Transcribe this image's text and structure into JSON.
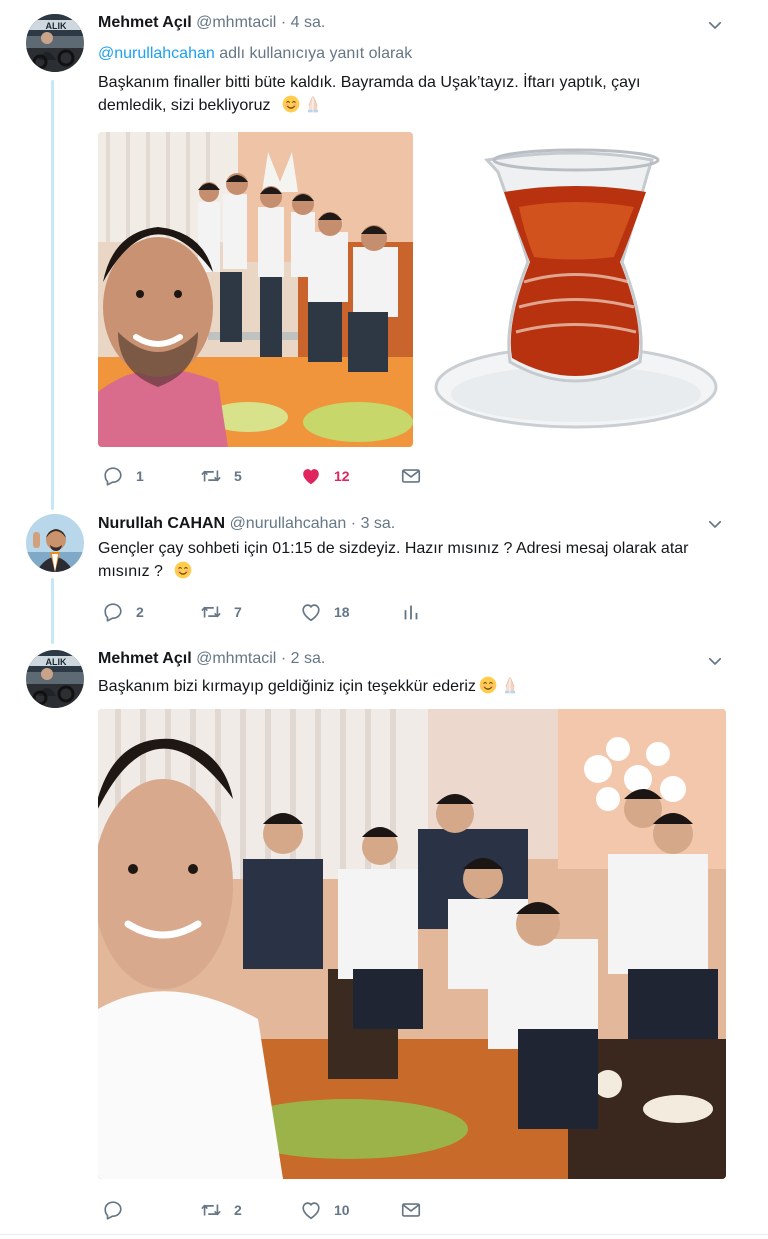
{
  "tweets": [
    {
      "name": "Mehmet Açıl",
      "handle": "@mhmtacil",
      "dot": "·",
      "time": "4 sa.",
      "reply_to_mention": "@nurullahcahan",
      "reply_to_suffix": " adlı kullanıcıya yanıt olarak",
      "text_line1": "Başkanım finaller bitti büte kaldık. Bayramda da Uşak’tayız. İftarı yaptık, çayı",
      "text_line2": "demledik, sizi bekliyoruz",
      "emojis": [
        "smiling-face-emoji",
        "folded-hands-emoji"
      ],
      "media": [
        "group-selfie-photo",
        "turkish-tea-glass-photo"
      ],
      "counts": {
        "reply": "1",
        "retweet": "5",
        "like": "12"
      },
      "liked": true
    },
    {
      "name": "Nurullah CAHAN",
      "handle": "@nurullahcahan",
      "dot": "·",
      "time": "3 sa.",
      "text_line1": "Gençler çay sohbeti için 01:15 de sizdeyiz. Hazır mısınız ? Adresi mesaj olarak atar",
      "text_line2": "mısınız ?",
      "emojis": [
        "smiling-face-emoji"
      ],
      "counts": {
        "reply": "2",
        "retweet": "7",
        "like": "18"
      },
      "liked": false
    },
    {
      "name": "Mehmet Açıl",
      "handle": "@mhmtacil",
      "dot": "·",
      "time": "2 sa.",
      "text_line1": "Başkanım bizi kırmayıp geldiğiniz için teşekkür ederiz",
      "emojis": [
        "smiling-face-emoji",
        "folded-hands-emoji"
      ],
      "media": [
        "group-gathering-photo"
      ],
      "counts": {
        "retweet": "2",
        "like": "10"
      },
      "liked": false
    }
  ],
  "colors": {
    "accent": "#1da1f2",
    "like": "#e0245e",
    "muted": "#657786",
    "thread_line": "#c4e8f9"
  }
}
